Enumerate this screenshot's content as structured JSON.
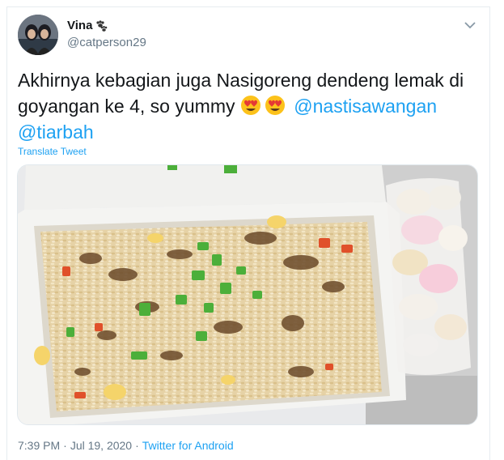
{
  "tweet": {
    "display_name": "Vina",
    "name_emoji": "paw-prints-icon",
    "handle": "@catperson29",
    "text_part1": "Akhirnya kebagian juga Nasigoreng dendeng lemak di goyangan ke 4, so yummy ",
    "emojis": [
      "heart-eyes-emoji",
      "heart-eyes-emoji"
    ],
    "mention1": "@nastisawangan",
    "mention2": "@tiarbah",
    "translate_label": "Translate Tweet",
    "time": "7:39 PM",
    "separator": "·",
    "date": "Jul 19, 2020",
    "client": "Twitter for Android",
    "photo_alt_icon": "fried-rice-photo"
  },
  "colors": {
    "link": "#1da1f2",
    "text": "#14171a",
    "muted": "#657786",
    "border": "#e6ecf0"
  }
}
